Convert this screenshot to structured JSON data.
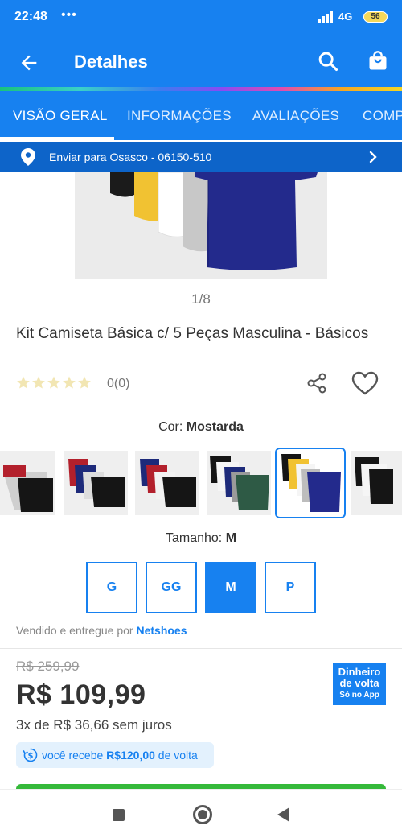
{
  "status_bar": {
    "time": "22:48",
    "dots": "•••",
    "network": "4G",
    "battery": "56"
  },
  "app_bar": {
    "title": "Detalhes",
    "back_icon": "arrow-left-icon",
    "search_icon": "search-icon",
    "bag_icon": "shopping-bag-icon"
  },
  "tabs": [
    {
      "label": "VISÃO GERAL",
      "active": true
    },
    {
      "label": "INFORMAÇÕES",
      "active": false
    },
    {
      "label": "AVALIAÇÕES",
      "active": false
    },
    {
      "label": "COMP",
      "active": false
    }
  ],
  "shipping": {
    "text": "Enviar para Osasco - 06150-510"
  },
  "gallery": {
    "counter": "1/8"
  },
  "product": {
    "title": "Kit Camiseta Básica c/ 5 Peças Masculina - Básicos",
    "rating_text": "0(0)",
    "stars": 0
  },
  "color": {
    "label": "Cor:",
    "value": "Mostarda"
  },
  "size": {
    "label": "Tamanho:",
    "value": "M",
    "options": [
      "G",
      "GG",
      "M",
      "P"
    ],
    "selected": "M"
  },
  "seller": {
    "prefix": "Vendido e entregue por",
    "name": "Netshoes"
  },
  "pricing": {
    "old_price": "R$ 259,99",
    "price": "R$ 109,99",
    "installments": "3x de R$ 36,66 sem juros",
    "cashback_prefix": "você recebe",
    "cashback_amount": "R$120,00",
    "cashback_suffix": "de volta"
  },
  "badge": {
    "line1": "Dinheiro",
    "line2": "de volta",
    "line3": "Só no App"
  },
  "colors": {
    "primary": "#1781f0",
    "dark_blue": "#0d64c9",
    "buy_green": "#35b93a",
    "star_empty": "#f2e6b3"
  }
}
